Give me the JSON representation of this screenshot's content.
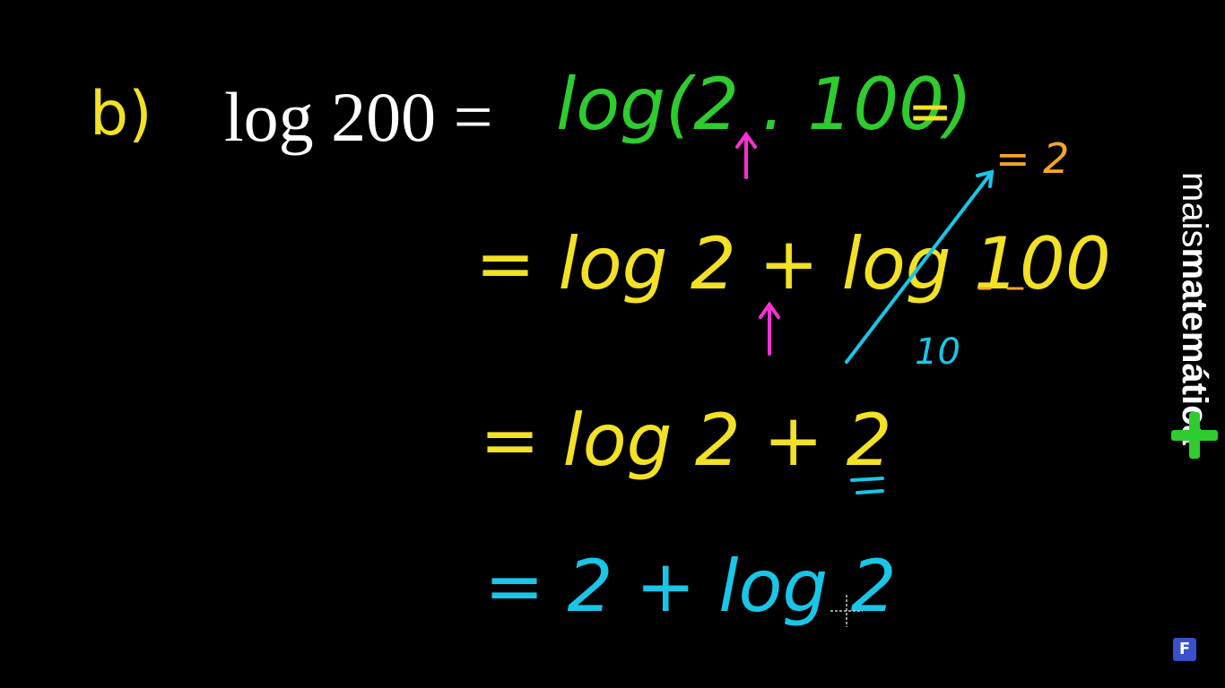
{
  "problem": {
    "label": "b)",
    "expression": "log 200 ="
  },
  "steps": {
    "line1": "log(2 . 100)",
    "line1_equals": "=",
    "line2": "= log 2 + log 100",
    "annotation_result": "= 2",
    "annotation_base": "10",
    "line3": "= log 2 + 2",
    "line4": "= 2 + log 2"
  },
  "brand": {
    "light": "mais",
    "bold": "matemática"
  },
  "badge": {
    "letter": "F"
  },
  "colors": {
    "background": "#000000",
    "green": "#2ecc2e",
    "yellow": "#f2e125",
    "cyan": "#18c6e8",
    "orange": "#f5a623",
    "pink": "#ff2fd4"
  }
}
